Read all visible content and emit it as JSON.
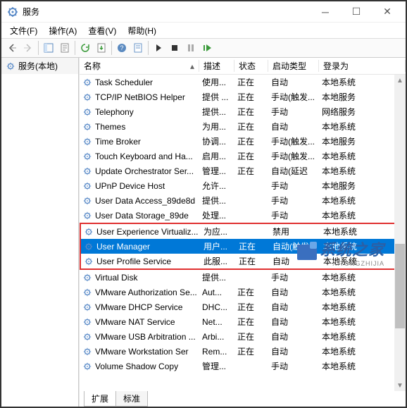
{
  "window": {
    "title": "服务"
  },
  "menu": {
    "file": "文件(F)",
    "action": "操作(A)",
    "view": "查看(V)",
    "help": "帮助(H)"
  },
  "sidebar": {
    "label": "服务(本地)"
  },
  "columns": {
    "name": "名称",
    "desc": "描述",
    "status": "状态",
    "startup": "启动类型",
    "logon": "登录为"
  },
  "tabs": {
    "extended": "扩展",
    "standard": "标准"
  },
  "watermark": {
    "cn": "系统之家",
    "en": "XITONGZHIJIA"
  },
  "services": [
    {
      "name": "Task Scheduler",
      "desc": "使用...",
      "status": "正在",
      "startup": "自动",
      "logon": "本地系统"
    },
    {
      "name": "TCP/IP NetBIOS Helper",
      "desc": "提供 ...",
      "status": "正在",
      "startup": "手动(触发...",
      "logon": "本地服务"
    },
    {
      "name": "Telephony",
      "desc": "提供...",
      "status": "正在",
      "startup": "手动",
      "logon": "网络服务"
    },
    {
      "name": "Themes",
      "desc": "为用...",
      "status": "正在",
      "startup": "自动",
      "logon": "本地系统"
    },
    {
      "name": "Time Broker",
      "desc": "协调...",
      "status": "正在",
      "startup": "手动(触发...",
      "logon": "本地服务"
    },
    {
      "name": "Touch Keyboard and Ha...",
      "desc": "启用...",
      "status": "正在",
      "startup": "手动(触发...",
      "logon": "本地系统"
    },
    {
      "name": "Update Orchestrator Ser...",
      "desc": "管理...",
      "status": "正在",
      "startup": "自动(延迟",
      "logon": "本地系统"
    },
    {
      "name": "UPnP Device Host",
      "desc": "允许...",
      "status": "",
      "startup": "手动",
      "logon": "本地服务"
    },
    {
      "name": "User Data Access_89de8d",
      "desc": "提供...",
      "status": "",
      "startup": "手动",
      "logon": "本地系统"
    },
    {
      "name": "User Data Storage_89de",
      "desc": "处理...",
      "status": "",
      "startup": "手动",
      "logon": "本地系统"
    },
    {
      "name": "User Experience Virtualiz...",
      "desc": "为应...",
      "status": "",
      "startup": "禁用",
      "logon": "本地系统"
    },
    {
      "name": "User Manager",
      "desc": "用户...",
      "status": "正在",
      "startup": "自动(触发...",
      "logon": "本地系统",
      "selected": true
    },
    {
      "name": "User Profile Service",
      "desc": "此服...",
      "status": "正在",
      "startup": "自动",
      "logon": "本地系统"
    },
    {
      "name": "Virtual Disk",
      "desc": "提供...",
      "status": "",
      "startup": "手动",
      "logon": "本地系统"
    },
    {
      "name": "VMware Authorization Se...",
      "desc": "Aut...",
      "status": "正在",
      "startup": "自动",
      "logon": "本地系统"
    },
    {
      "name": "VMware DHCP Service",
      "desc": "DHC...",
      "status": "正在",
      "startup": "自动",
      "logon": "本地系统"
    },
    {
      "name": "VMware NAT Service",
      "desc": "Net...",
      "status": "正在",
      "startup": "自动",
      "logon": "本地系统"
    },
    {
      "name": "VMware USB Arbitration ...",
      "desc": "Arbi...",
      "status": "正在",
      "startup": "自动",
      "logon": "本地系统"
    },
    {
      "name": "VMware Workstation Ser",
      "desc": "Rem...",
      "status": "正在",
      "startup": "自动",
      "logon": "本地系统"
    },
    {
      "name": "Volume Shadow Copy",
      "desc": "管理...",
      "status": "",
      "startup": "手动",
      "logon": "本地系统"
    }
  ]
}
